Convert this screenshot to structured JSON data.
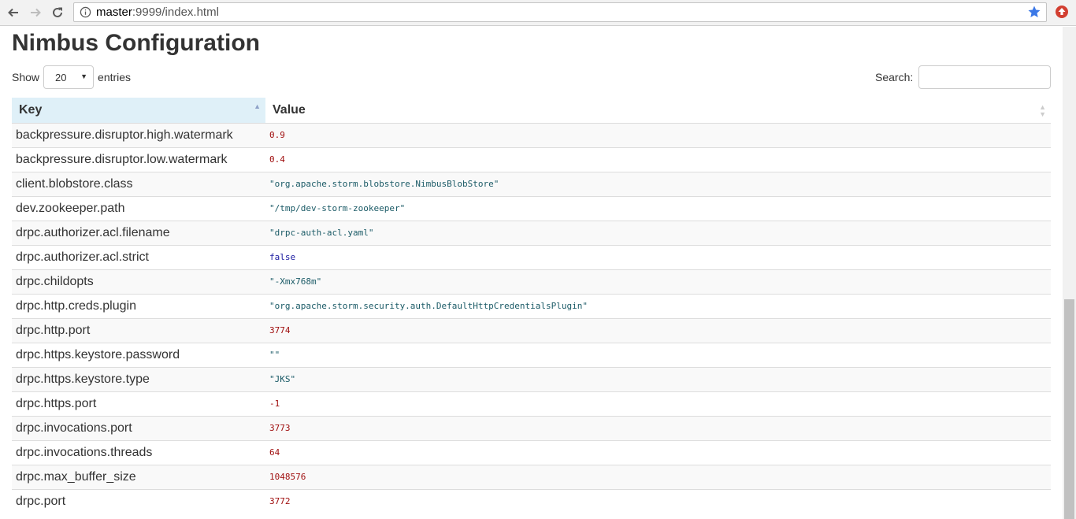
{
  "browser": {
    "url_host": "master",
    "url_rest": ":9999/index.html",
    "icons": {
      "back": "arrow-left-icon",
      "forward": "arrow-right-icon",
      "reload": "reload-icon",
      "info": "info-icon",
      "bookmark": "star-icon",
      "extension": "extension-up-arrow-icon"
    },
    "colors": {
      "star": "#3b78e7",
      "extension": "#d23f31"
    }
  },
  "page": {
    "title": "Nimbus Configuration"
  },
  "length_control": {
    "show_label": "Show",
    "selected": "20",
    "entries_label": "entries"
  },
  "search": {
    "label": "Search:",
    "value": ""
  },
  "table": {
    "columns": [
      "Key",
      "Value"
    ],
    "sorted_column": "Key",
    "rows": [
      {
        "key": "backpressure.disruptor.high.watermark",
        "value": "0.9",
        "type": "number"
      },
      {
        "key": "backpressure.disruptor.low.watermark",
        "value": "0.4",
        "type": "number"
      },
      {
        "key": "client.blobstore.class",
        "value": "\"org.apache.storm.blobstore.NimbusBlobStore\"",
        "type": "string"
      },
      {
        "key": "dev.zookeeper.path",
        "value": "\"/tmp/dev-storm-zookeeper\"",
        "type": "string"
      },
      {
        "key": "drpc.authorizer.acl.filename",
        "value": "\"drpc-auth-acl.yaml\"",
        "type": "string"
      },
      {
        "key": "drpc.authorizer.acl.strict",
        "value": "false",
        "type": "bool"
      },
      {
        "key": "drpc.childopts",
        "value": "\"-Xmx768m\"",
        "type": "string"
      },
      {
        "key": "drpc.http.creds.plugin",
        "value": "\"org.apache.storm.security.auth.DefaultHttpCredentialsPlugin\"",
        "type": "string"
      },
      {
        "key": "drpc.http.port",
        "value": "3774",
        "type": "number"
      },
      {
        "key": "drpc.https.keystore.password",
        "value": "\"\"",
        "type": "string"
      },
      {
        "key": "drpc.https.keystore.type",
        "value": "\"JKS\"",
        "type": "string"
      },
      {
        "key": "drpc.https.port",
        "value": "-1",
        "type": "number"
      },
      {
        "key": "drpc.invocations.port",
        "value": "3773",
        "type": "number"
      },
      {
        "key": "drpc.invocations.threads",
        "value": "64",
        "type": "number"
      },
      {
        "key": "drpc.max_buffer_size",
        "value": "1048576",
        "type": "number"
      },
      {
        "key": "drpc.port",
        "value": "3772",
        "type": "number"
      }
    ]
  }
}
